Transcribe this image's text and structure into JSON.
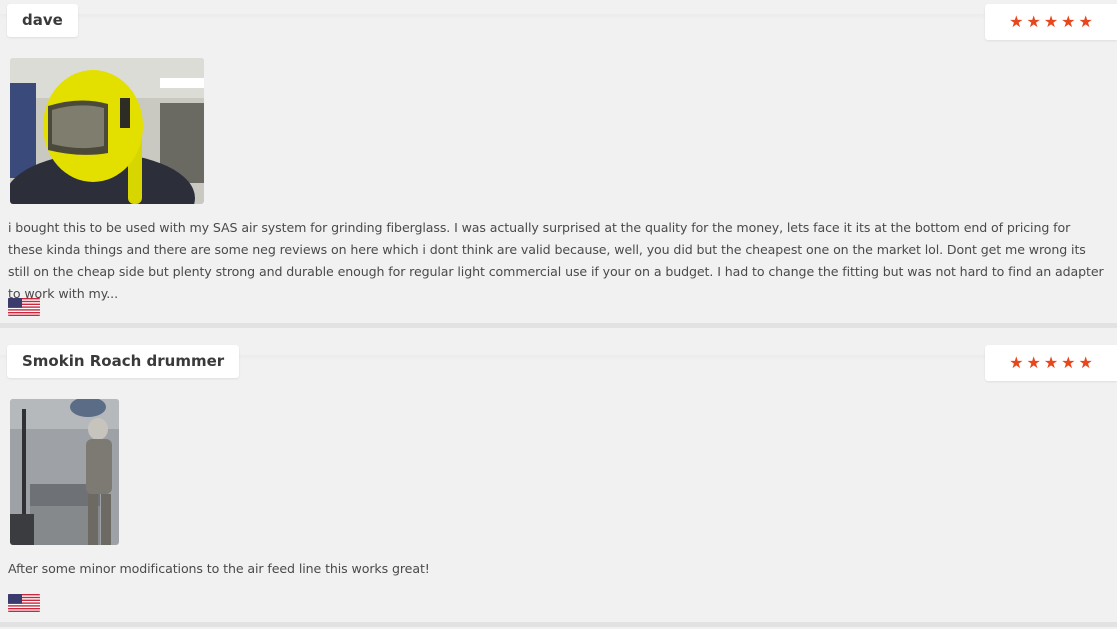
{
  "reviews": [
    {
      "author": "dave",
      "rating": 5,
      "text": "i bought this to be used with my SAS air system for grinding fiberglass. I was actually surprised at the quality for the money, lets face it its at the bottom end of pricing for these kinda things and there are some neg reviews on here which i dont think are valid because, well, you did but the cheapest one on the market lol. Dont get me wrong its still on the cheap side but plenty strong and durable enough for regular light commercial use if your on a budget. I had to change the fitting but was not hard to find an adapter to work with my...",
      "photo_icon": "yellow-helmet-photo",
      "country_icon": "us-flag-icon"
    },
    {
      "author": "Smokin Roach drummer",
      "rating": 5,
      "text": "After some minor modifications to the air feed line this works great!",
      "photo_icon": "blast-booth-photo",
      "country_icon": "us-flag-icon"
    }
  ],
  "colors": {
    "star": "#e8461c",
    "background": "#f1f1f1",
    "card": "#ffffff",
    "divider": "#e2e2e2"
  }
}
